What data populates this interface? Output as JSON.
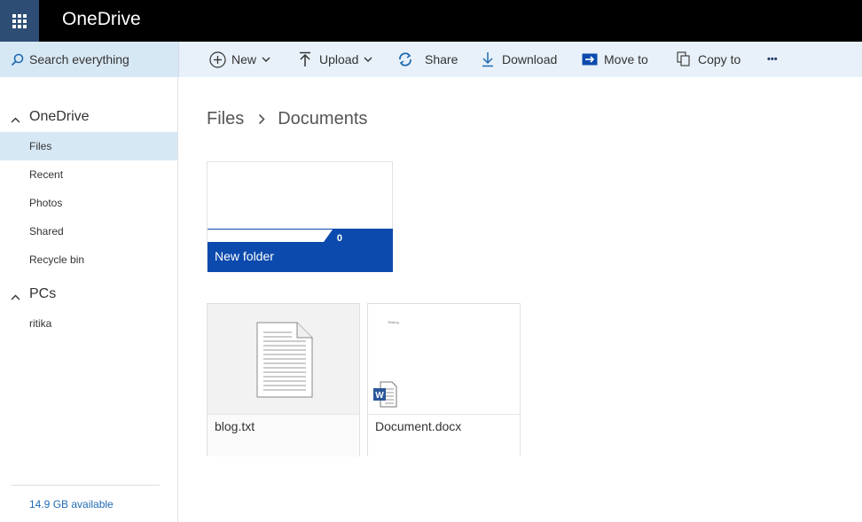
{
  "app": {
    "title": "OneDrive"
  },
  "search": {
    "label": "Search everything"
  },
  "toolbar": {
    "new_label": "New",
    "upload_label": "Upload",
    "share_label": "Share",
    "download_label": "Download",
    "move_label": "Move to",
    "copy_label": "Copy to",
    "more_label": "•••"
  },
  "nav": {
    "onedrive_section": "OneDrive",
    "items": [
      {
        "label": "Files"
      },
      {
        "label": "Recent"
      },
      {
        "label": "Photos"
      },
      {
        "label": "Shared"
      },
      {
        "label": "Recycle bin"
      }
    ],
    "pcs_section": "PCs",
    "pcs": [
      {
        "label": "ritika"
      }
    ],
    "storage": "14.9 GB available"
  },
  "breadcrumb": {
    "root": "Files",
    "current": "Documents"
  },
  "folders": [
    {
      "name": "New folder",
      "count": "0"
    }
  ],
  "files": [
    {
      "name": "blog.txt"
    },
    {
      "name": "Document.docx",
      "preview": "Testing"
    }
  ],
  "colors": {
    "accent": "#0c4aad",
    "topbar": "#000000",
    "waffle": "#2d4d74",
    "selected": "#d7e8f5",
    "link": "#1f6bb3"
  }
}
